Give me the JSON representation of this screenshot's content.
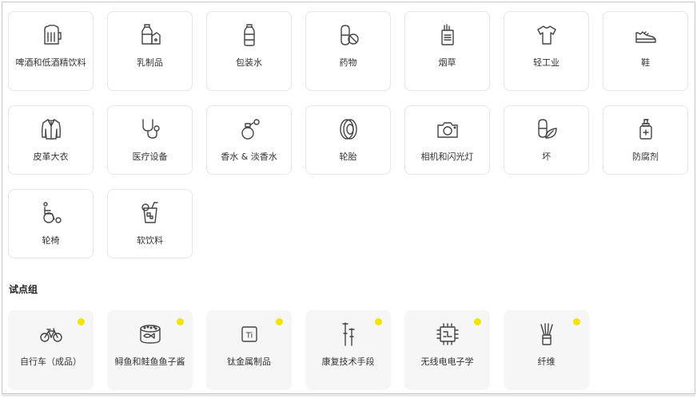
{
  "categories_row1": [
    {
      "label": "啤酒和低酒精饮料",
      "icon": "beer-mug-icon"
    },
    {
      "label": "乳制品",
      "icon": "milk-carton-icon"
    },
    {
      "label": "包装水",
      "icon": "water-bottle-icon"
    },
    {
      "label": "药物",
      "icon": "pill-icon"
    },
    {
      "label": "烟草",
      "icon": "cigarette-pack-icon"
    },
    {
      "label": "轻工业",
      "icon": "tshirt-icon"
    },
    {
      "label": "鞋",
      "icon": "shoe-icon"
    }
  ],
  "categories_row2": [
    {
      "label": "皮革大衣",
      "icon": "coat-icon"
    },
    {
      "label": "医疗设备",
      "icon": "stethoscope-icon"
    },
    {
      "label": "香水 & 淡香水",
      "icon": "perfume-icon"
    },
    {
      "label": "轮胎",
      "icon": "tire-icon"
    },
    {
      "label": "相机和闪光灯",
      "icon": "camera-icon"
    },
    {
      "label": "坏",
      "icon": "leaf-pill-icon"
    },
    {
      "label": "防腐剂",
      "icon": "sanitizer-icon"
    }
  ],
  "categories_row3": [
    {
      "label": "轮椅",
      "icon": "wheelchair-icon"
    },
    {
      "label": "软饮料",
      "icon": "soft-drink-icon"
    }
  ],
  "pilot_section": {
    "title": "试点组",
    "items": [
      {
        "label": "自行车（成品）",
        "icon": "bicycle-icon"
      },
      {
        "label": "鲟鱼和鲑鱼鱼子酱",
        "icon": "caviar-can-icon"
      },
      {
        "label": "钛金属制品",
        "icon": "titanium-icon",
        "symbol": "Ti"
      },
      {
        "label": "康复技术手段",
        "icon": "crutches-icon"
      },
      {
        "label": "无线电电子学",
        "icon": "microchip-icon"
      },
      {
        "label": "纤维",
        "icon": "fiber-optic-icon"
      }
    ]
  },
  "colors": {
    "dot": "#f0e600",
    "card_border": "#e6e6e6",
    "pilot_card_bg": "#f6f6f6"
  }
}
